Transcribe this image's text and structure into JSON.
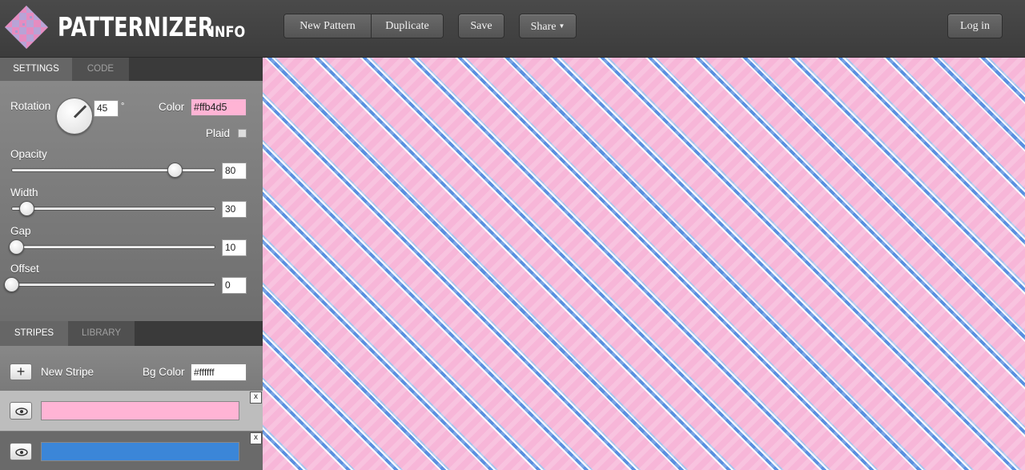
{
  "header": {
    "logo_text": "PATTERNIZER",
    "info_label": "INFO",
    "buttons": {
      "new_pattern": "New Pattern",
      "duplicate": "Duplicate",
      "save": "Save",
      "share": "Share",
      "login": "Log in"
    }
  },
  "settings_tabs": {
    "settings": "SETTINGS",
    "code": "CODE"
  },
  "settings": {
    "rotation_label": "Rotation",
    "rotation_value": "45",
    "degree_symbol": "°",
    "color_label": "Color",
    "color_value": "#ffb4d5",
    "plaid_label": "Plaid",
    "opacity_label": "Opacity",
    "opacity_value": "80",
    "width_label": "Width",
    "width_value": "30",
    "gap_label": "Gap",
    "gap_value": "10",
    "offset_label": "Offset",
    "offset_value": "0"
  },
  "stripes_tabs": {
    "stripes": "STRIPES",
    "library": "LIBRARY"
  },
  "stripes": {
    "new_stripe_label": "New Stripe",
    "bg_color_label": "Bg Color",
    "bg_color_value": "#ffffff",
    "close_symbol": "x",
    "items": [
      {
        "color": "#ffb4d5"
      },
      {
        "color": "#3b86d8"
      }
    ]
  },
  "colors": {
    "canvas_bg": "#f7b6d8",
    "stripe_blue": "#5a8fe0"
  }
}
